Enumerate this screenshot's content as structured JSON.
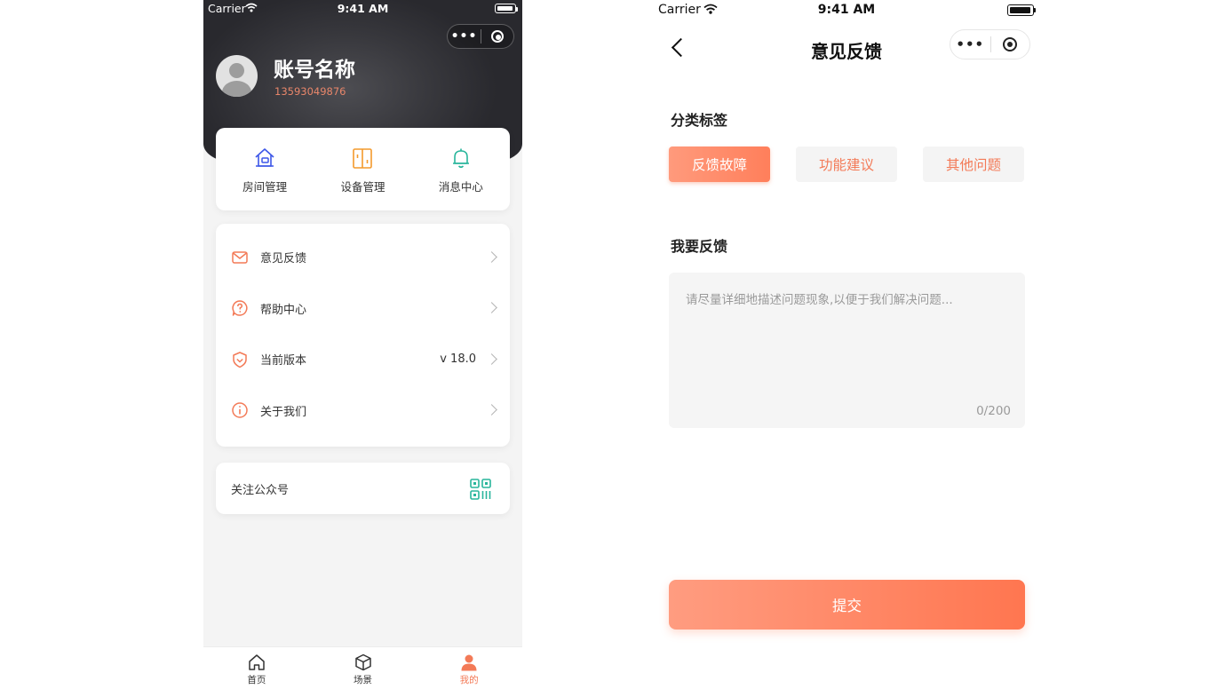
{
  "profile_screen": {
    "status_bar": {
      "carrier": "Carrier",
      "time": "9:41 AM"
    },
    "capsule": {
      "more": "•••"
    },
    "account": {
      "name": "账号名称",
      "phone": "13593049876"
    },
    "quick_actions": [
      {
        "label": "房间管理",
        "icon": "house-icon",
        "color": "#3d57e8"
      },
      {
        "label": "设备管理",
        "icon": "device-icon",
        "color": "#f39a2c"
      },
      {
        "label": "消息中心",
        "icon": "bell-icon",
        "color": "#28b59b"
      }
    ],
    "menu_items": [
      {
        "label": "意见反馈",
        "icon": "mail-icon",
        "value": ""
      },
      {
        "label": "帮助中心",
        "icon": "help-icon",
        "value": ""
      },
      {
        "label": "当前版本",
        "icon": "shield-icon",
        "value": "v 18.0"
      },
      {
        "label": "关于我们",
        "icon": "info-icon",
        "value": ""
      }
    ],
    "follow": {
      "label": "关注公众号",
      "icon": "qr-code-icon"
    },
    "tabs": [
      {
        "label": "首页",
        "icon": "home-icon",
        "active": false
      },
      {
        "label": "场景",
        "icon": "cube-icon",
        "active": false
      },
      {
        "label": "我的",
        "icon": "user-icon",
        "active": true
      }
    ]
  },
  "feedback_screen": {
    "status_bar": {
      "carrier": "Carrier",
      "time": "9:41 AM"
    },
    "capsule": {
      "more": "•••"
    },
    "title": "意见反馈",
    "category_label": "分类标签",
    "tags": [
      {
        "label": "反馈故障",
        "selected": true
      },
      {
        "label": "功能建议",
        "selected": false
      },
      {
        "label": "其他问题",
        "selected": false
      }
    ],
    "feedback_label": "我要反馈",
    "feedback_input": {
      "value": "",
      "placeholder": "请尽量详细地描述问题现象,以便于我们解决问题..."
    },
    "char_count": "0/200",
    "submit_label": "提交"
  },
  "colors": {
    "accent": "#f37a57",
    "primary_blue": "#3d57e8",
    "device_orange": "#f39a2c",
    "teal": "#28b59b"
  }
}
